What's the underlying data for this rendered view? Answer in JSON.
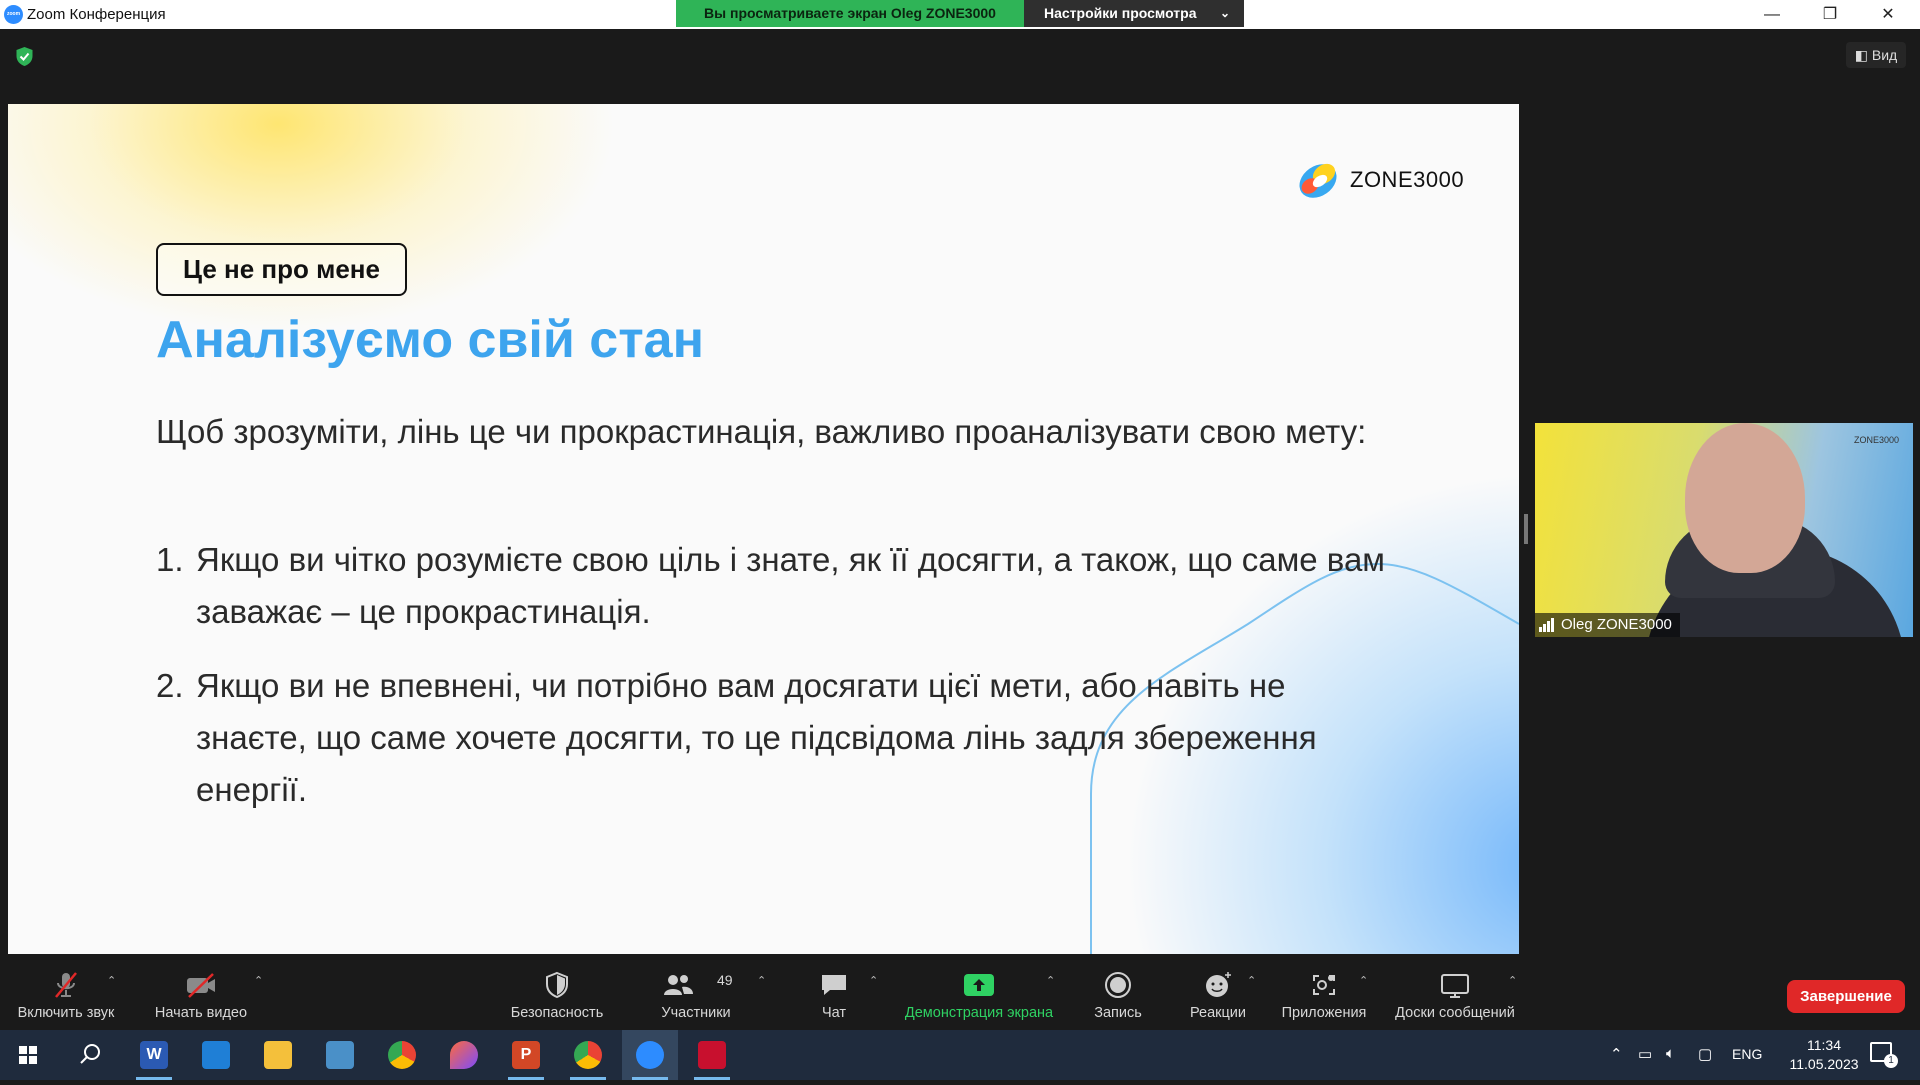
{
  "window": {
    "app_logo_text": "zoom",
    "title": "Zoom Конференция",
    "controls": [
      "—",
      "❐",
      "✕"
    ]
  },
  "share_banner": {
    "viewing_text": "Вы просматриваете экран Oleg ZONE3000",
    "view_settings_label": "Настройки просмотра"
  },
  "header": {
    "view_label": "Вид"
  },
  "slide": {
    "brand": "ZONE3000",
    "tag": "Це не про мене",
    "heading": "Аналізуємо свій стан",
    "intro": "Щоб зрозуміти, лінь це чи прокрастинація, важливо проаналізувати свою мету:",
    "items": [
      {
        "num": "1.",
        "text": "Якщо ви чітко розумієте свою ціль і знате, як її досягти, а також, що саме вам заважає – це прокрастинація."
      },
      {
        "num": "2.",
        "text": "Якщо ви не впевнені, чи потрібно вам досягати цієї мети, або навіть не знаєте, що саме хочете досягти, то це підсвідома лінь задля збереження енергії."
      }
    ],
    "colors": {
      "heading": "#3da4ee"
    }
  },
  "participant": {
    "name": "Oleg ZONE3000",
    "mini_logo": "ZONE3000"
  },
  "toolbar": {
    "items": [
      {
        "label": "Включить звук",
        "icon": "muted-mic-icon"
      },
      {
        "label": "Начать видео",
        "icon": "video-off-icon"
      },
      {
        "label": "Безопасность",
        "icon": "shield-icon"
      },
      {
        "label": "Участники",
        "icon": "participants-icon",
        "count": "49"
      },
      {
        "label": "Чат",
        "icon": "chat-icon"
      },
      {
        "label": "Демонстрация экрана",
        "icon": "share-screen-icon"
      },
      {
        "label": "Запись",
        "icon": "record-icon"
      },
      {
        "label": "Реакции",
        "icon": "reactions-icon"
      },
      {
        "label": "Приложения",
        "icon": "apps-icon"
      },
      {
        "label": "Доски сообщений",
        "icon": "whiteboard-icon"
      }
    ],
    "end_label": "Завершение",
    "colors": {
      "share_active": "#2fd263",
      "end": "#e02828"
    }
  },
  "taskbar": {
    "apps": [
      "start-icon",
      "search-icon",
      "word-icon",
      "mail-icon",
      "explorer-icon",
      "control-panel-icon",
      "chrome-icon",
      "drop-app-icon",
      "powerpoint-icon",
      "chrome-profile-icon",
      "zoom-icon",
      "acrobat-icon"
    ],
    "language": "ENG",
    "time": "11:34",
    "date": "11.05.2023",
    "notification_count": "1"
  }
}
